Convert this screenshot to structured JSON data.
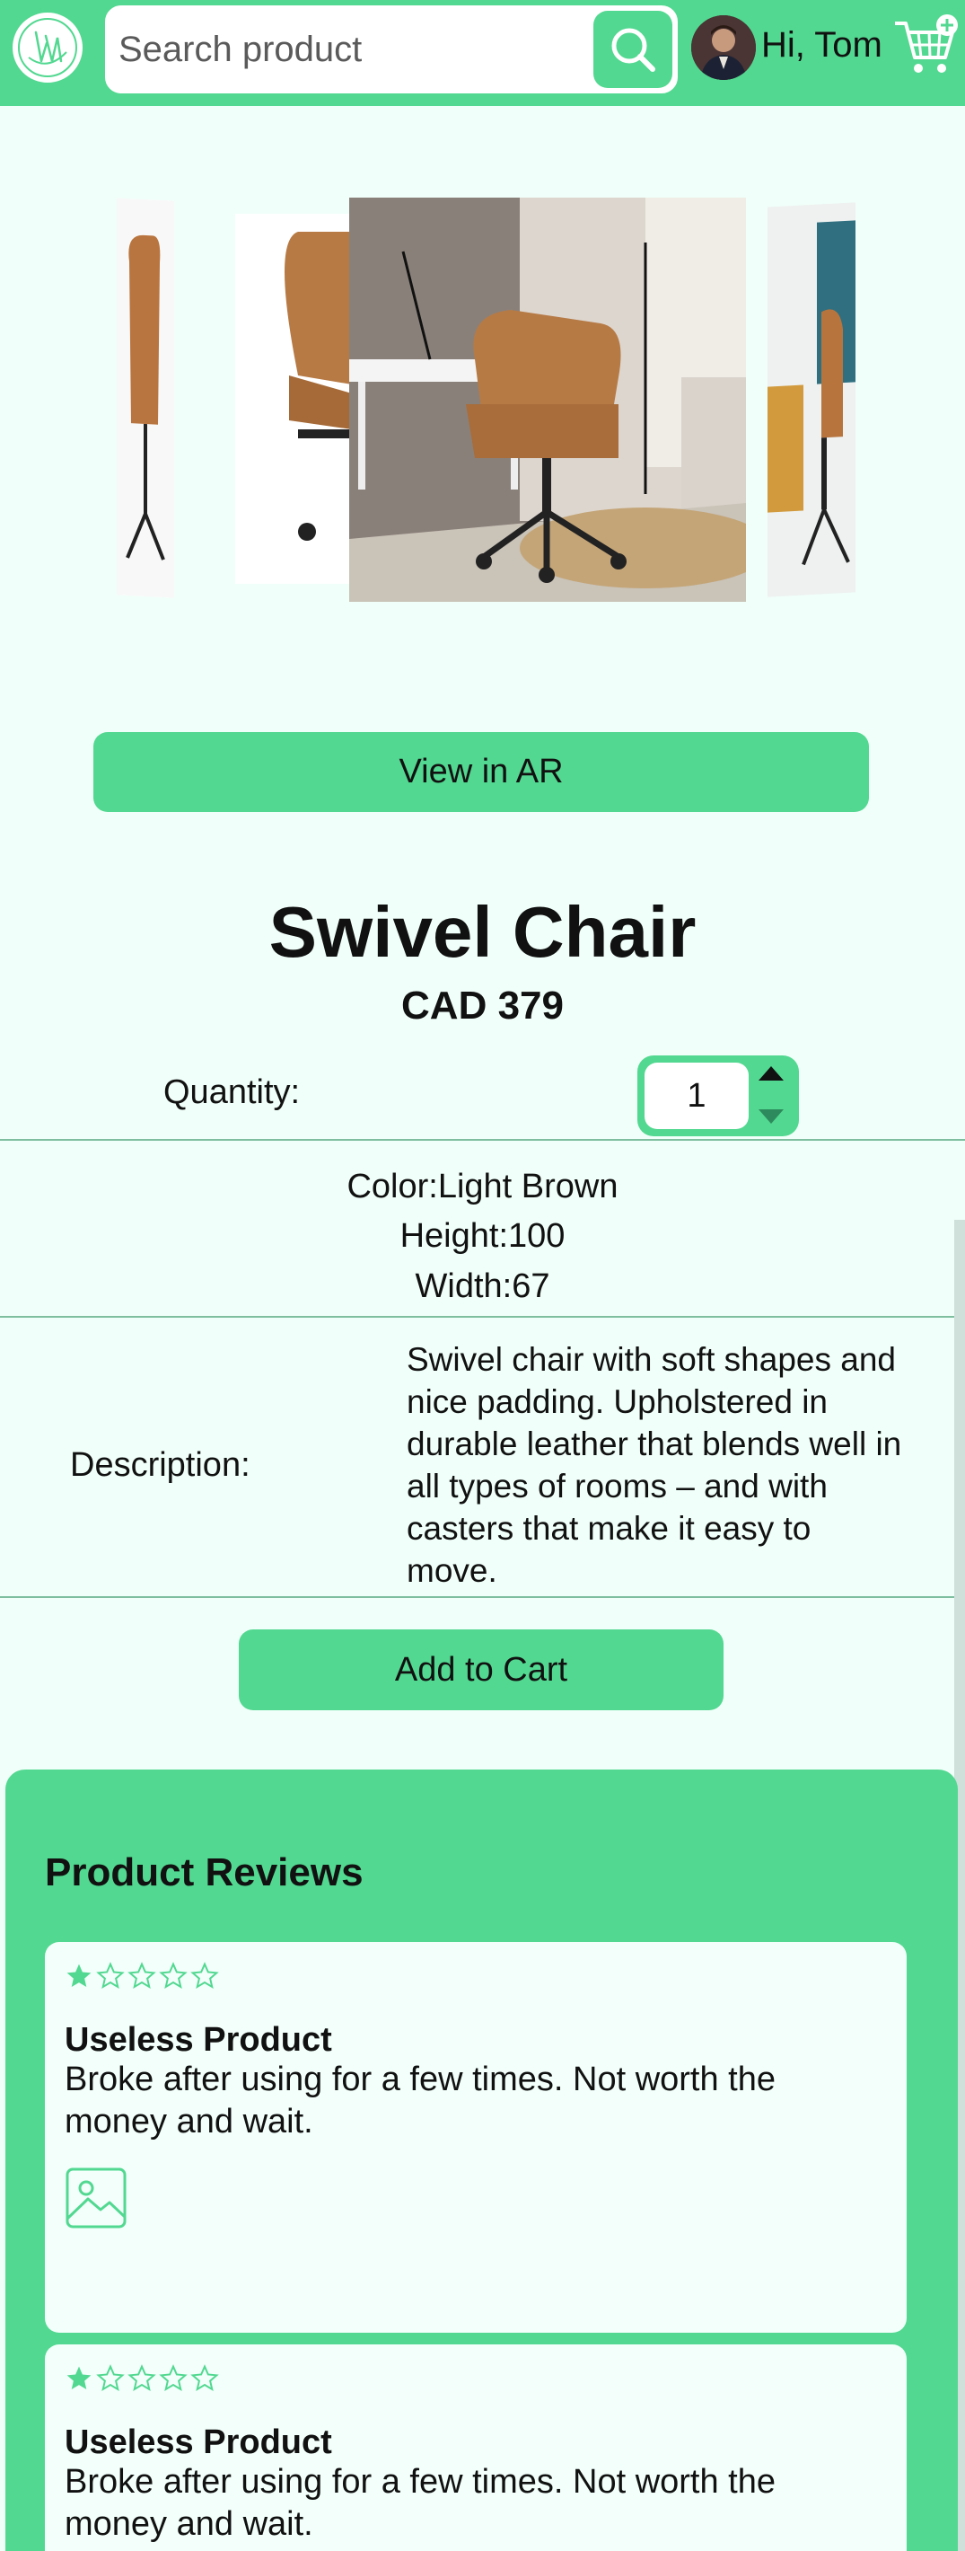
{
  "colors": {
    "accent": "#52d890",
    "background": "#f0fff9",
    "divider": "#7fbfa0"
  },
  "header": {
    "logo_text": "NM",
    "search_placeholder": "Search product",
    "greeting": "Hi, Tom",
    "icons": [
      "search-icon",
      "cart-add-icon"
    ]
  },
  "ar_button_label": "View in AR",
  "product": {
    "name": "Swivel Chair",
    "price": "CAD 379",
    "quantity_label": "Quantity:",
    "quantity": "1",
    "specs": [
      "Color:Light Brown",
      "Height:100",
      "Width:67"
    ],
    "description_label": "Description:",
    "description": "Swivel chair with soft shapes and nice padding. Upholstered in durable leather that blends well in all types of rooms – and with casters that make it easy to move."
  },
  "add_to_cart_label": "Add to Cart",
  "reviews": {
    "title": "Product Reviews",
    "items": [
      {
        "rating": 1,
        "max_rating": 5,
        "title": "Useless Product",
        "text": "Broke after using for a few times. Not worth the money and wait."
      },
      {
        "rating": 1,
        "max_rating": 5,
        "title": "Useless Product",
        "text": "Broke after using for a few times. Not worth the money and wait."
      }
    ]
  }
}
